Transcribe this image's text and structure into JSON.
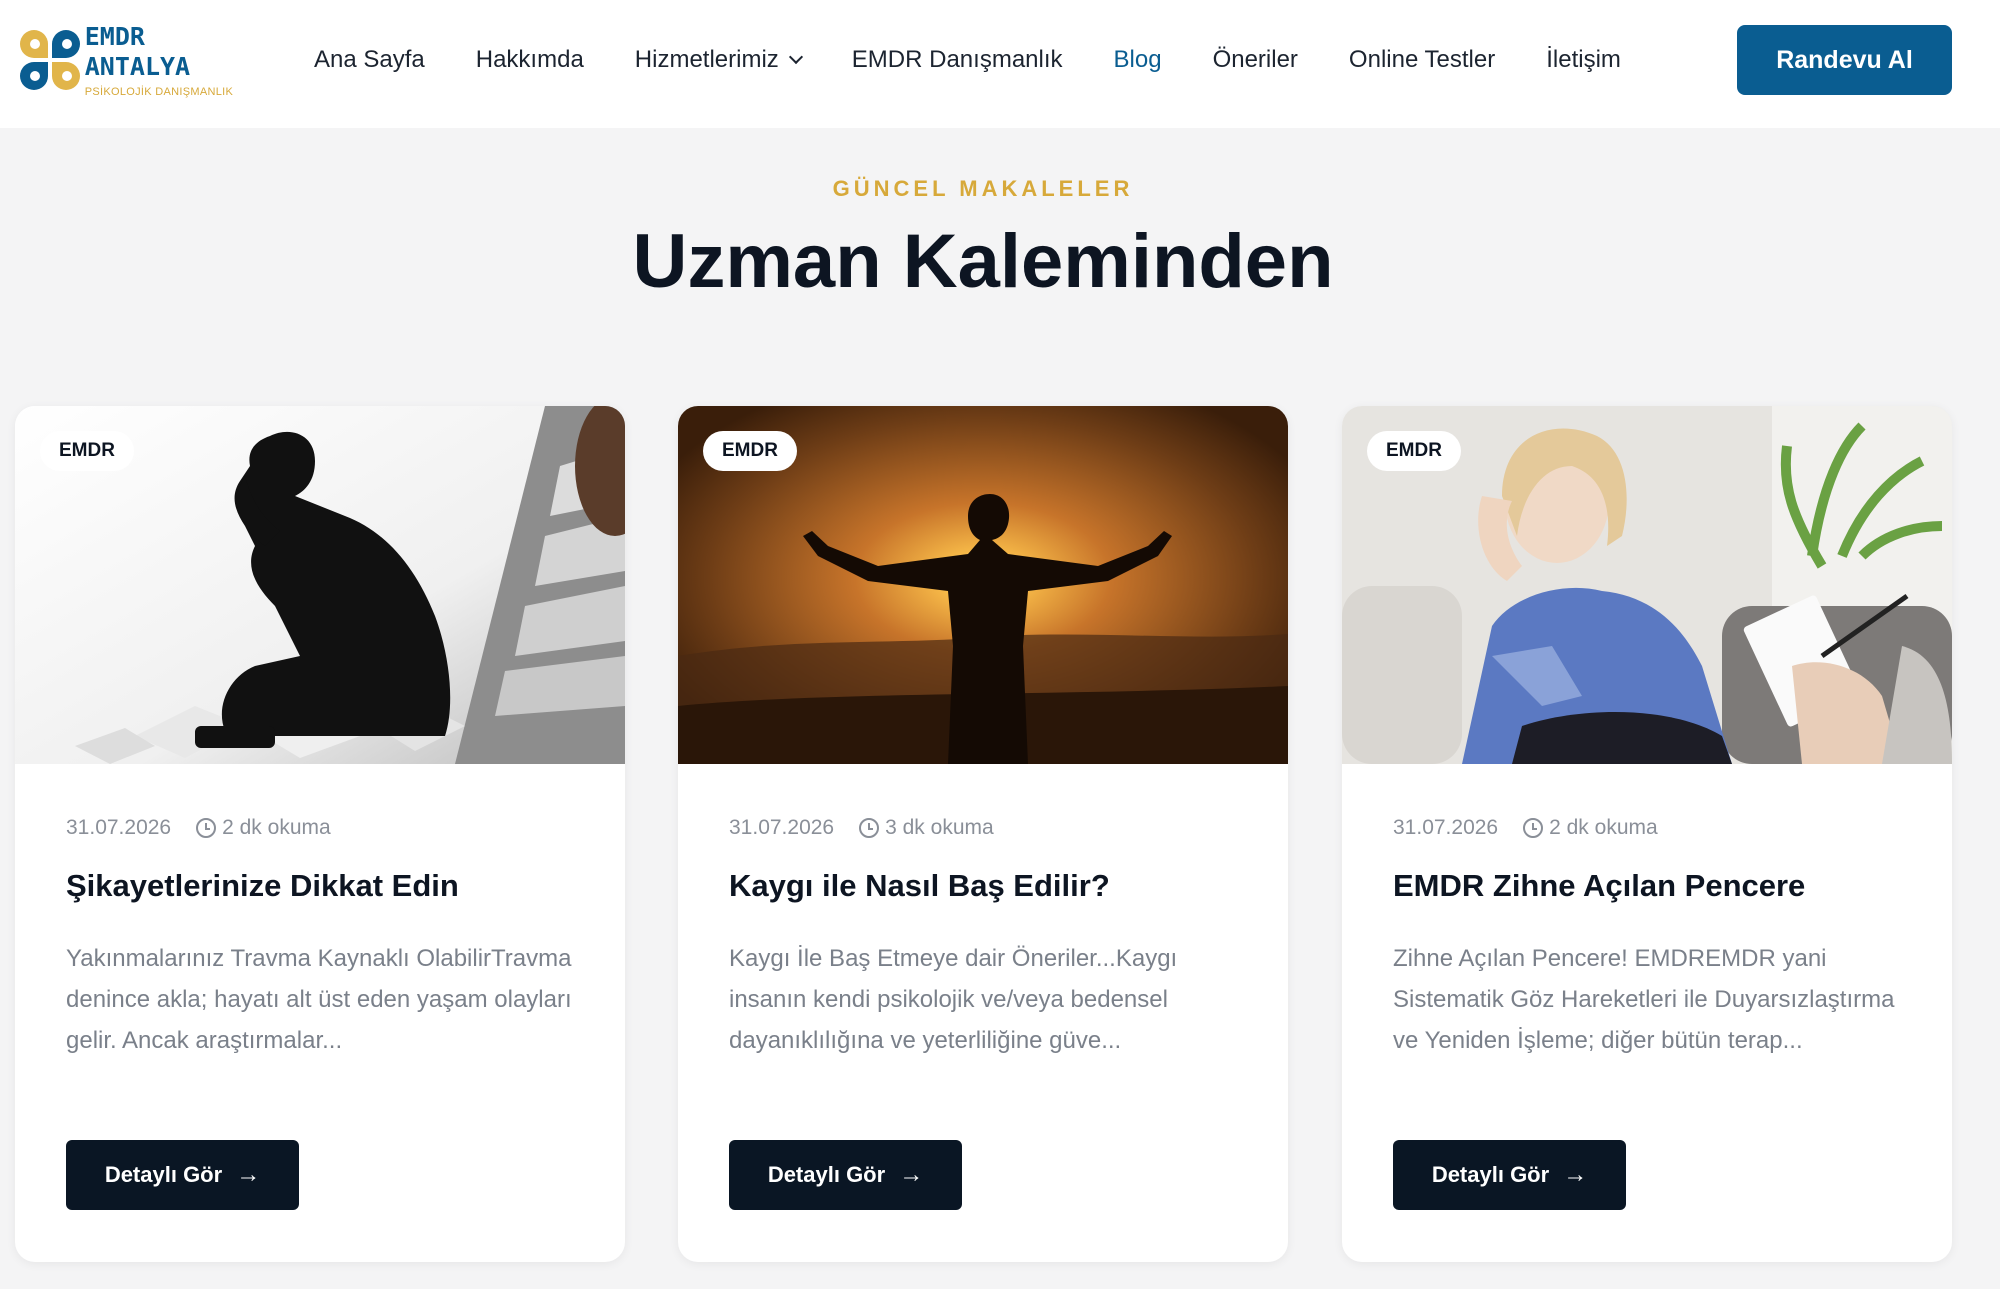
{
  "header": {
    "logo": {
      "title": "EMDR ANTALYA",
      "subtitle": "PSİKOLOJİK DANIŞMANLIK"
    },
    "nav": [
      {
        "label": "Ana Sayfa"
      },
      {
        "label": "Hakkımda"
      },
      {
        "label": "Hizmetlerimiz",
        "has_dropdown": true
      },
      {
        "label": "EMDR Danışmanlık"
      },
      {
        "label": "Blog",
        "active": true
      },
      {
        "label": "Öneriler"
      },
      {
        "label": "Online Testler"
      },
      {
        "label": "İletişim"
      }
    ],
    "cta_label": "Randevu Al"
  },
  "section": {
    "eyebrow": "GÜNCEL MAKALELER",
    "title": "Uzman Kaleminden"
  },
  "cards": [
    {
      "tag": "EMDR",
      "date": "31.07.2026",
      "read_time": "2 dk okuma",
      "title": "Şikayetlerinize Dikkat Edin",
      "excerpt": "Yakınmalarınız Travma Kaynaklı OlabilirTravma denince akla; hayatı alt üst eden yaşam olayları gelir. Ancak araştırmalar...",
      "button_label": "Detaylı Gör",
      "image": "silhouette-man-head-in-hand-icon"
    },
    {
      "tag": "EMDR",
      "date": "31.07.2026",
      "read_time": "3 dk okuma",
      "title": "Kaygı ile Nasıl Baş Edilir?",
      "excerpt": "Kaygı İle Baş Etmeye dair Öneriler...Kaygı insanın kendi psikolojik ve/veya bedensel dayanıklılığına ve yeterliliğine güve...",
      "button_label": "Detaylı Gör",
      "image": "man-arms-open-sunset-icon"
    },
    {
      "tag": "EMDR",
      "date": "31.07.2026",
      "read_time": "2 dk okuma",
      "title": "EMDR Zihne Açılan Pencere",
      "excerpt": "Zihne Açılan Pencere! EMDREMDR yani Sistematik Göz Hareketleri ile Duyarsızlaştırma ve Yeniden İşleme; diğer bütün terap...",
      "button_label": "Detaylı Gör",
      "image": "woman-therapy-session-icon"
    }
  ],
  "colors": {
    "brand_blue": "#0a5d91",
    "brand_gold": "#d7a93a",
    "dark": "#0a1624",
    "page_bg": "#f4f4f5"
  }
}
